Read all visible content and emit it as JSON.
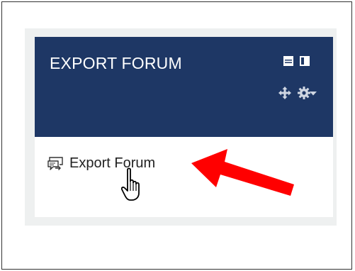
{
  "block": {
    "title": "EXPORT FORUM",
    "header_color": "#1e3765",
    "header_icons": [
      "dock-icon",
      "sidebar-icon",
      "move-icon",
      "gear-icon",
      "caret-down-icon"
    ]
  },
  "content": {
    "link_label": "Export Forum",
    "link_icon": "forum-export-icon"
  },
  "annotation": {
    "arrow_color": "#ff0000",
    "cursor": "hand-pointer-icon"
  }
}
